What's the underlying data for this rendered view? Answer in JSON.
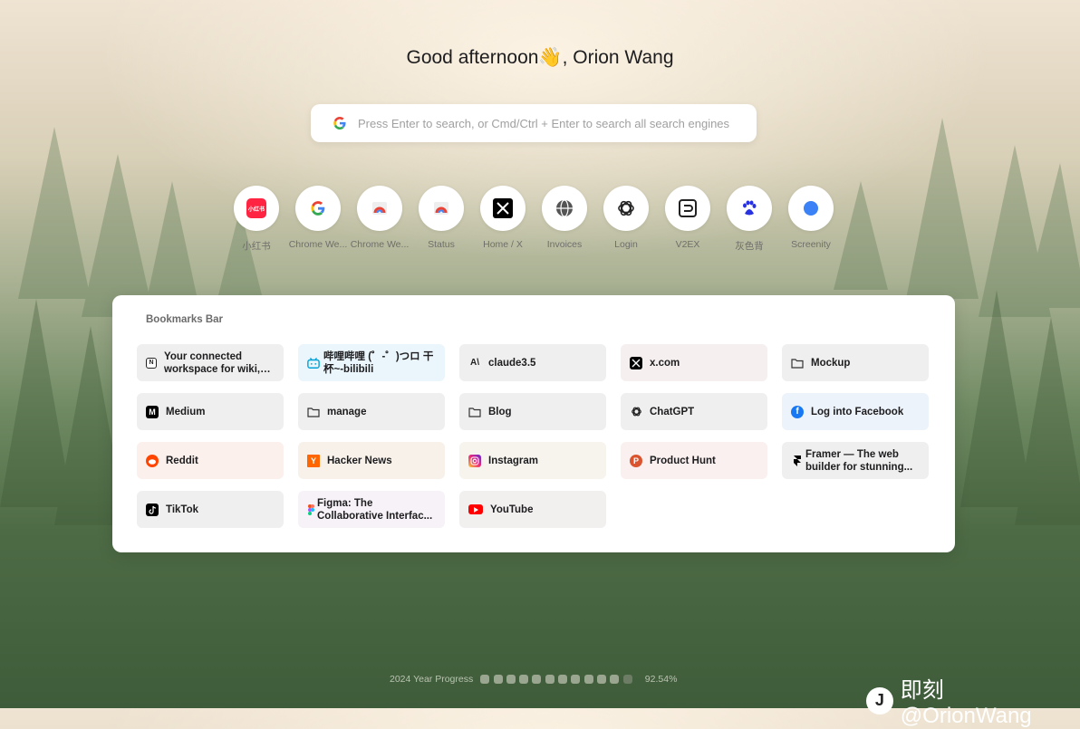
{
  "greeting": "Good afternoon👋, Orion Wang",
  "search": {
    "placeholder": "Press Enter to search, or Cmd/Ctrl + Enter to search all search engines",
    "engine_icon": "google-icon"
  },
  "shortcuts": [
    {
      "label": "小红书",
      "icon": "xiaohongshu-icon",
      "logo_text": "小红书"
    },
    {
      "label": "Chrome We...",
      "icon": "google-icon"
    },
    {
      "label": "Chrome We...",
      "icon": "chrome-webstore-icon"
    },
    {
      "label": "Status",
      "icon": "chrome-webstore-icon"
    },
    {
      "label": "Home / X",
      "icon": "x-icon"
    },
    {
      "label": "Invoices",
      "icon": "globe-icon"
    },
    {
      "label": "Login",
      "icon": "openai-icon"
    },
    {
      "label": "V2EX",
      "icon": "v2ex-icon"
    },
    {
      "label": "灰色背",
      "icon": "baidu-paw-icon"
    },
    {
      "label": "Screenity",
      "icon": "screenity-icon"
    }
  ],
  "bookmarks": {
    "title": "Bookmarks Bar",
    "items": [
      {
        "label": "Your connected workspace for wiki, do...",
        "icon": "notion-icon"
      },
      {
        "label": "哔哩哔哩 (゜-゜)つロ 干杯~-bilibili",
        "icon": "bilibili-icon"
      },
      {
        "label": "claude3.5",
        "icon": "anthropic-icon"
      },
      {
        "label": "x.com",
        "icon": "x-icon"
      },
      {
        "label": "Mockup",
        "icon": "folder-icon"
      },
      {
        "label": "Medium",
        "icon": "medium-icon"
      },
      {
        "label": "manage",
        "icon": "folder-icon"
      },
      {
        "label": "Blog",
        "icon": "folder-icon"
      },
      {
        "label": "ChatGPT",
        "icon": "openai-icon"
      },
      {
        "label": "Log into Facebook",
        "icon": "facebook-icon"
      },
      {
        "label": "Reddit",
        "icon": "reddit-icon"
      },
      {
        "label": "Hacker News",
        "icon": "hackernews-icon"
      },
      {
        "label": "Instagram",
        "icon": "instagram-icon"
      },
      {
        "label": "Product Hunt",
        "icon": "producthunt-icon"
      },
      {
        "label": "Framer — The web builder for stunning...",
        "icon": "framer-icon"
      },
      {
        "label": "TikTok",
        "icon": "tiktok-icon"
      },
      {
        "label": "Figma: The Collaborative Interfac...",
        "icon": "figma-icon"
      },
      {
        "label": "YouTube",
        "icon": "youtube-icon"
      }
    ]
  },
  "year_progress": {
    "label": "2024 Year Progress",
    "percent": "92.54%",
    "value": 0.9254
  },
  "watermark": {
    "logo": "J",
    "text": "即刻 @OrionWang"
  }
}
